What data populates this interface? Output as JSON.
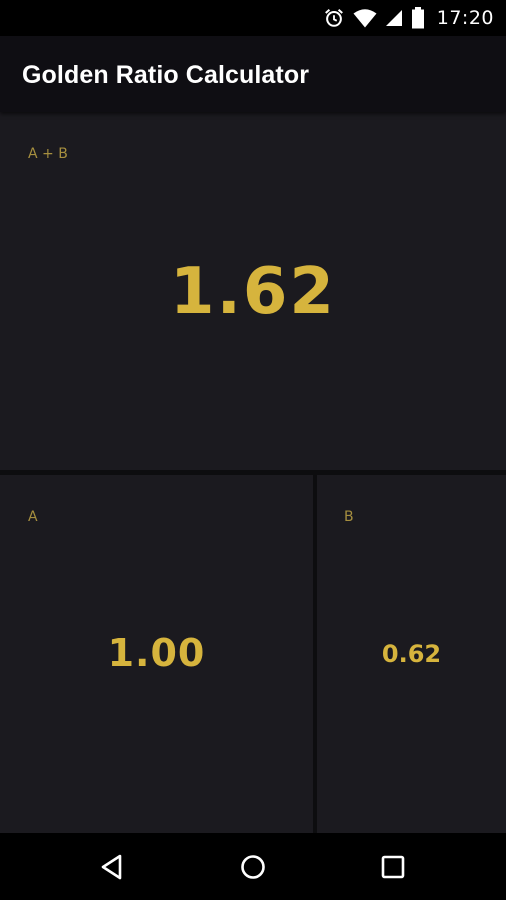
{
  "status_bar": {
    "time": "17:20",
    "icons": [
      "alarm-icon",
      "wifi-icon",
      "signal-icon",
      "battery-icon"
    ]
  },
  "app_bar": {
    "title": "Golden Ratio Calculator"
  },
  "panels": {
    "sum": {
      "label": "A + B",
      "value": "1.62"
    },
    "a": {
      "label": "A",
      "value": "1.00"
    },
    "b": {
      "label": "B",
      "value": "0.62"
    }
  },
  "nav_bar": {
    "icons": [
      "back-icon",
      "home-icon",
      "recents-icon"
    ]
  },
  "colors": {
    "accent": "#d6b43d",
    "label": "#a68f3f",
    "panel_bg": "#1b1a1f",
    "app_bar_bg": "#0f0e13"
  }
}
